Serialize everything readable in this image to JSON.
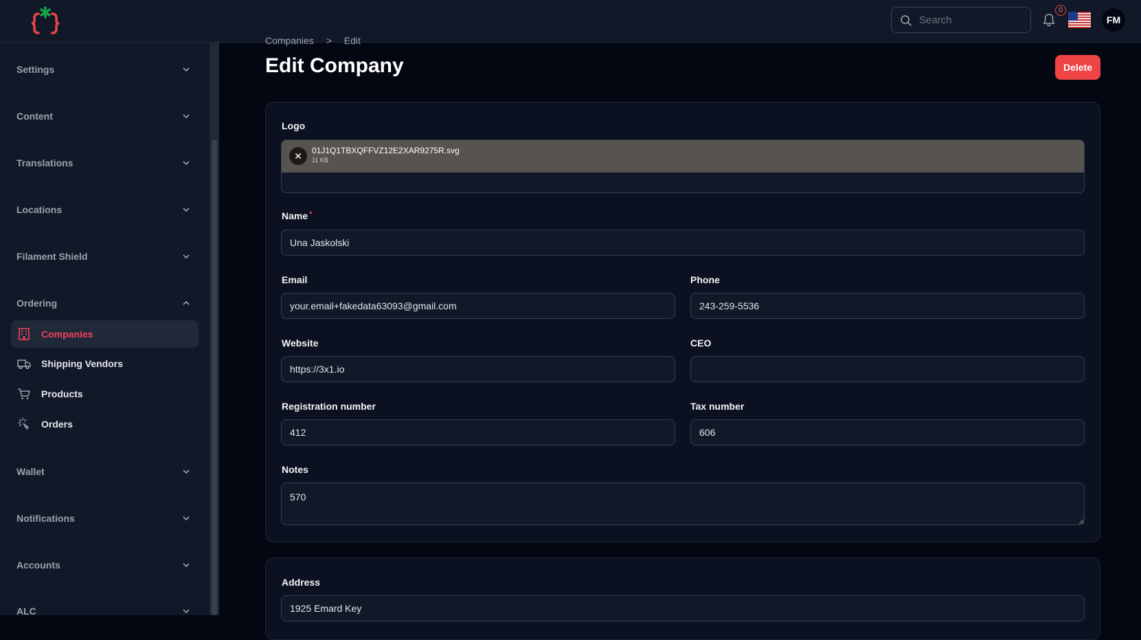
{
  "header": {
    "search_placeholder": "Search",
    "notification_count": "0",
    "avatar_initials": "FM",
    "accent_color": "#ef4444"
  },
  "sidebar": {
    "groups": [
      {
        "label": "Settings",
        "expanded": false
      },
      {
        "label": "Content",
        "expanded": false
      },
      {
        "label": "Translations",
        "expanded": false
      },
      {
        "label": "Locations",
        "expanded": false
      },
      {
        "label": "Filament Shield",
        "expanded": false
      },
      {
        "label": "Ordering",
        "expanded": true
      },
      {
        "label": "Wallet",
        "expanded": false
      },
      {
        "label": "Notifications",
        "expanded": false
      },
      {
        "label": "Accounts",
        "expanded": false
      },
      {
        "label": "ALC",
        "expanded": false
      }
    ],
    "ordering_items": [
      {
        "label": "Companies",
        "icon": "building-icon",
        "active": true
      },
      {
        "label": "Shipping Vendors",
        "icon": "truck-icon",
        "active": false
      },
      {
        "label": "Products",
        "icon": "cart-icon",
        "active": false
      },
      {
        "label": "Orders",
        "icon": "cursor-click-icon",
        "active": false
      }
    ]
  },
  "breadcrumb": {
    "parent": "Companies",
    "separator": ">",
    "current": "Edit"
  },
  "page": {
    "title": "Edit Company",
    "delete_label": "Delete"
  },
  "form": {
    "logo": {
      "label": "Logo",
      "file_name": "01J1Q1TBXQFFVZ12E2XAR9275R.svg",
      "file_size": "11 KB"
    },
    "name": {
      "label": "Name",
      "required_mark": "*",
      "value": "Una Jaskolski"
    },
    "email": {
      "label": "Email",
      "value": "your.email+fakedata63093@gmail.com"
    },
    "phone": {
      "label": "Phone",
      "value": "243-259-5536"
    },
    "website": {
      "label": "Website",
      "value": "https://3x1.io"
    },
    "ceo": {
      "label": "CEO",
      "value": ""
    },
    "registration_number": {
      "label": "Registration number",
      "value": "412"
    },
    "tax_number": {
      "label": "Tax number",
      "value": "606"
    },
    "notes": {
      "label": "Notes",
      "value": "570"
    },
    "address": {
      "label": "Address",
      "value": "1925 Emard Key"
    }
  }
}
